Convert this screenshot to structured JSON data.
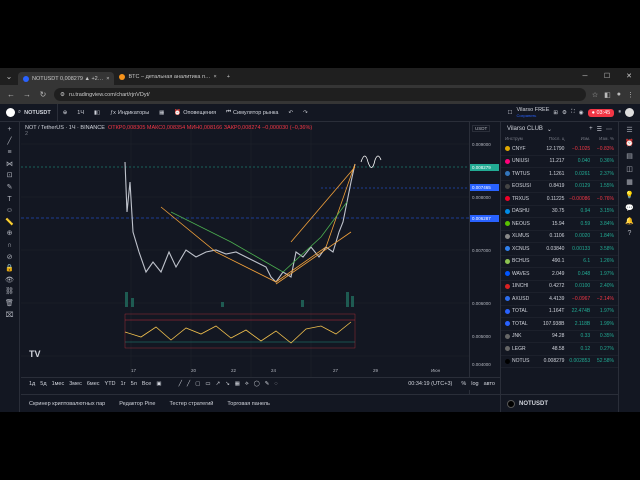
{
  "browser": {
    "tabs": [
      {
        "label": "NOTUSDT 0,008279 ▲ +2…",
        "active": true
      },
      {
        "label": "BTC – детальная аналитика п…",
        "active": false
      }
    ],
    "new_tab": "+",
    "url": "ru.tradingview.com/chart/rjnVDyt/"
  },
  "header": {
    "symbol": "NOTUSDT",
    "interval": "1Ч",
    "indicators_label": "Индикаторы",
    "alerts_label": "Оповещения",
    "replay_label": "Симулятор рынка",
    "user_name": "Vilarso FREE",
    "user_sub": "Сохранить",
    "rec_time": "03:45"
  },
  "legend": {
    "title": "NOT / TetherUS · 1Ч · BINANCE",
    "ohlc": "ОТКР0,008305  МАКС0,008354  МИН0,008166  ЗАКР0,008274  −0,000030 (−0,36%)",
    "sub": "2"
  },
  "price_axis": {
    "currency": "USDT",
    "labels": [
      "0.009000",
      "0.008000",
      "0.007000",
      "0.006000",
      "0.005000",
      "0.004000"
    ],
    "tags": [
      {
        "text": "0.008279",
        "color": "#22ab94"
      },
      {
        "text": "0.007465",
        "color": "#2962ff"
      },
      {
        "text": "0.006287",
        "color": "#2962ff"
      }
    ]
  },
  "time_axis": {
    "labels": [
      "17",
      "20",
      "22",
      "24",
      "27",
      "29",
      "Июн"
    ]
  },
  "timeframe": {
    "ranges": [
      "1д",
      "5д",
      "1мес",
      "3мес",
      "6мес",
      "YTD",
      "1г",
      "5л",
      "Все"
    ],
    "clock": "00:34:19 (UTC+3)"
  },
  "bottom_panel": {
    "tabs": [
      "Скринер криптовалютных пар",
      "Редактор Pine",
      "Тестер стратегий",
      "Торговая панель"
    ]
  },
  "watchlist": {
    "title": "Vilarso CLUB",
    "columns": [
      "Инструм",
      "Посл. ц",
      "Изм.",
      "Изм. %"
    ],
    "rows": [
      {
        "name": "CNYF",
        "price": "12.1790",
        "chg": "−0.1025",
        "pct": "−0.83%",
        "color": "#e0a800"
      },
      {
        "name": "UNIUSI",
        "price": "11.217",
        "chg": "0.040",
        "pct": "0.36%",
        "color": "#ff007a"
      },
      {
        "name": "TWTUS",
        "price": "1.1261",
        "chg": "0.0261",
        "pct": "2.37%",
        "color": "#3375bb"
      },
      {
        "name": "EOSUSI",
        "price": "0.8419",
        "chg": "0.0129",
        "pct": "1.55%",
        "color": "#444"
      },
      {
        "name": "TRXUS",
        "price": "0.11225",
        "chg": "−0.00086",
        "pct": "−0.76%",
        "color": "#ef0027"
      },
      {
        "name": "DASHU",
        "price": "30.75",
        "chg": "0.94",
        "pct": "3.15%",
        "color": "#008ce7"
      },
      {
        "name": "NEOUS",
        "price": "15.94",
        "chg": "0.59",
        "pct": "3.84%",
        "color": "#58bf00"
      },
      {
        "name": "XLMUS",
        "price": "0.1106",
        "chg": "0.0020",
        "pct": "1.84%",
        "color": "#888"
      },
      {
        "name": "XCNUS",
        "price": "0.03840",
        "chg": "0.00133",
        "pct": "3.58%",
        "color": "#2f80ed"
      },
      {
        "name": "BCHUS",
        "price": "490.1",
        "chg": "6.1",
        "pct": "1.26%",
        "color": "#8dc351"
      },
      {
        "name": "WAVES",
        "price": "2.049",
        "chg": "0.048",
        "pct": "1.97%",
        "color": "#0055ff"
      },
      {
        "name": "1INCHI",
        "price": "0.4272",
        "chg": "0.0100",
        "pct": "2.40%",
        "color": "#d82122"
      },
      {
        "name": "AXUSD",
        "price": "4.4139",
        "chg": "−0.0967",
        "pct": "−2.14%",
        "color": "#2b6def"
      },
      {
        "name": "TOTAL",
        "price": "1.164T",
        "chg": "22.474B",
        "pct": "1.97%",
        "color": "#2962ff"
      },
      {
        "name": "TOTAL",
        "price": "107.938B",
        "chg": "2.118B",
        "pct": "1.99%",
        "color": "#2962ff"
      },
      {
        "name": "JNK",
        "price": "94.28",
        "chg": "0.33",
        "pct": "0.35%",
        "color": "#666"
      },
      {
        "name": "LEGR",
        "price": "48.58",
        "chg": "0.12",
        "pct": "0.27%",
        "color": "#666"
      },
      {
        "name": "NOTUS",
        "price": "0.008279",
        "chg": "0.002853",
        "pct": "52.58%",
        "color": "#000"
      }
    ],
    "footer_symbol": "NOTUSDT"
  },
  "colors": {
    "up": "#22ab94",
    "down": "#f23645",
    "accent": "#2962ff"
  }
}
